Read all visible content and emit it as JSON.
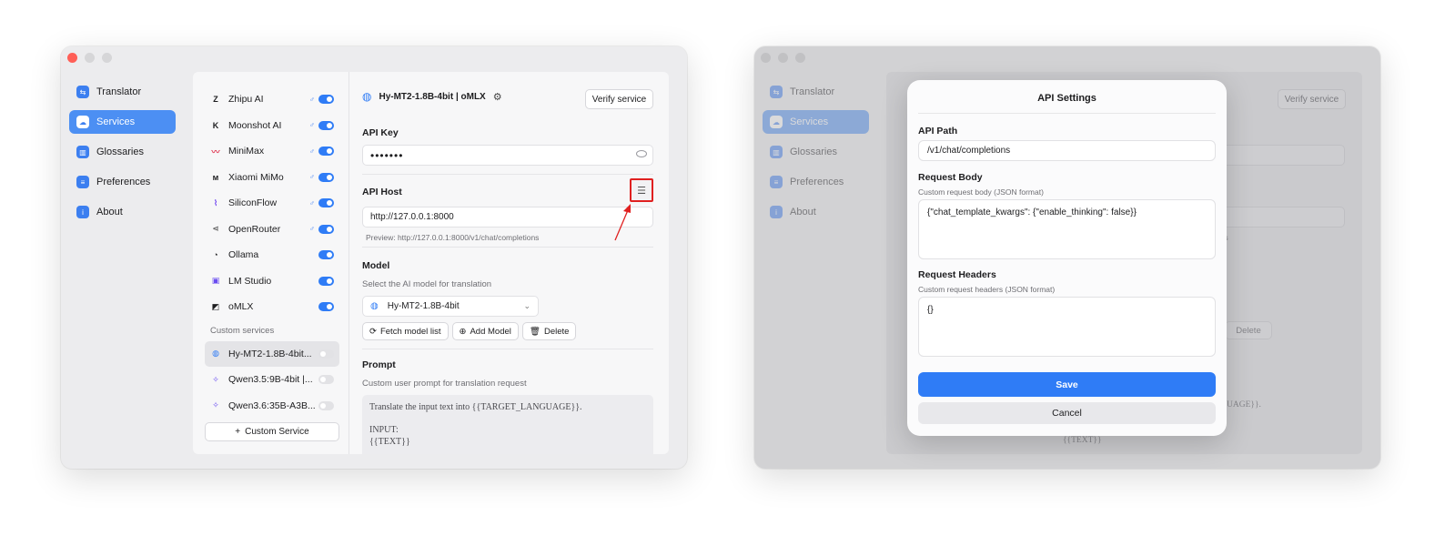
{
  "nav": [
    {
      "label": "Translator",
      "icon": "translate-icon",
      "glyph": "⇆",
      "active": false
    },
    {
      "label": "Services",
      "icon": "cloud-icon",
      "glyph": "☁",
      "active": true
    },
    {
      "label": "Glossaries",
      "icon": "book-icon",
      "glyph": "▥",
      "active": false
    },
    {
      "label": "Preferences",
      "icon": "list-icon",
      "glyph": "≡",
      "active": false
    },
    {
      "label": "About",
      "icon": "info-icon",
      "glyph": "i",
      "active": false
    }
  ],
  "services": [
    {
      "name": "Zhipu AI",
      "logo": "Z"
    },
    {
      "name": "Moonshot AI",
      "logo": "K"
    },
    {
      "name": "MiniMax",
      "logo": "〰"
    },
    {
      "name": "Xiaomi MiMo",
      "logo": "ᴍ"
    },
    {
      "name": "SiliconFlow",
      "logo": "⌇"
    },
    {
      "name": "OpenRouter",
      "logo": "⋖"
    },
    {
      "name": "Ollama",
      "logo": "◔"
    },
    {
      "name": "LM Studio",
      "logo": "▣"
    },
    {
      "name": "oMLX",
      "logo": "◩"
    }
  ],
  "custom_services_label": "Custom services",
  "custom_services": [
    {
      "name": "Hy-MT2-1.8B-4bit...",
      "logo": "◍"
    },
    {
      "name": "Qwen3.5:9B-4bit |...",
      "logo": "✧"
    },
    {
      "name": "Qwen3.6:35B-A3B...",
      "logo": "✧"
    }
  ],
  "add_custom_service": "Custom Service",
  "detail": {
    "title": "Hy-MT2-1.8B-4bit | oMLX",
    "verify_label": "Verify service",
    "api_key_label": "API Key",
    "api_key_value": "•••••••",
    "api_host_label": "API Host",
    "api_host_value": "http://127.0.0.1:8000",
    "preview": "Preview: http://127.0.0.1:8000/v1/chat/completions",
    "model_label": "Model",
    "model_sub": "Select the AI model for translation",
    "model_value": "Hy-MT2-1.8B-4bit",
    "fetch_label": "Fetch model list",
    "add_model_label": "Add Model",
    "delete_label": "Delete",
    "prompt_label": "Prompt",
    "prompt_sub": "Custom user prompt for translation request",
    "prompt_lines": [
      "Translate the input text into {{TARGET_LANGUAGE}}.",
      "",
      "INPUT:",
      "{{TEXT}}"
    ]
  },
  "ghost": {
    "verify_label": "Verify service",
    "delete_label": "Delete",
    "preview_tail": "ions",
    "prompt_tail": "UAGE}}.",
    "text_tail": "{{TEXT}}",
    "custom_service": "Custom Service"
  },
  "modal": {
    "title": "API Settings",
    "path_label": "API Path",
    "path_value": "/v1/chat/completions",
    "body_label": "Request Body",
    "body_sub": "Custom request body (JSON format)",
    "body_value": "{\"chat_template_kwargs\": {\"enable_thinking\": false}}",
    "headers_label": "Request Headers",
    "headers_sub": "Custom request headers (JSON format)",
    "headers_value": "{}",
    "save_label": "Save",
    "cancel_label": "Cancel"
  },
  "colors": {
    "accent": "#2f7cf6",
    "highlight": "#e02020"
  }
}
